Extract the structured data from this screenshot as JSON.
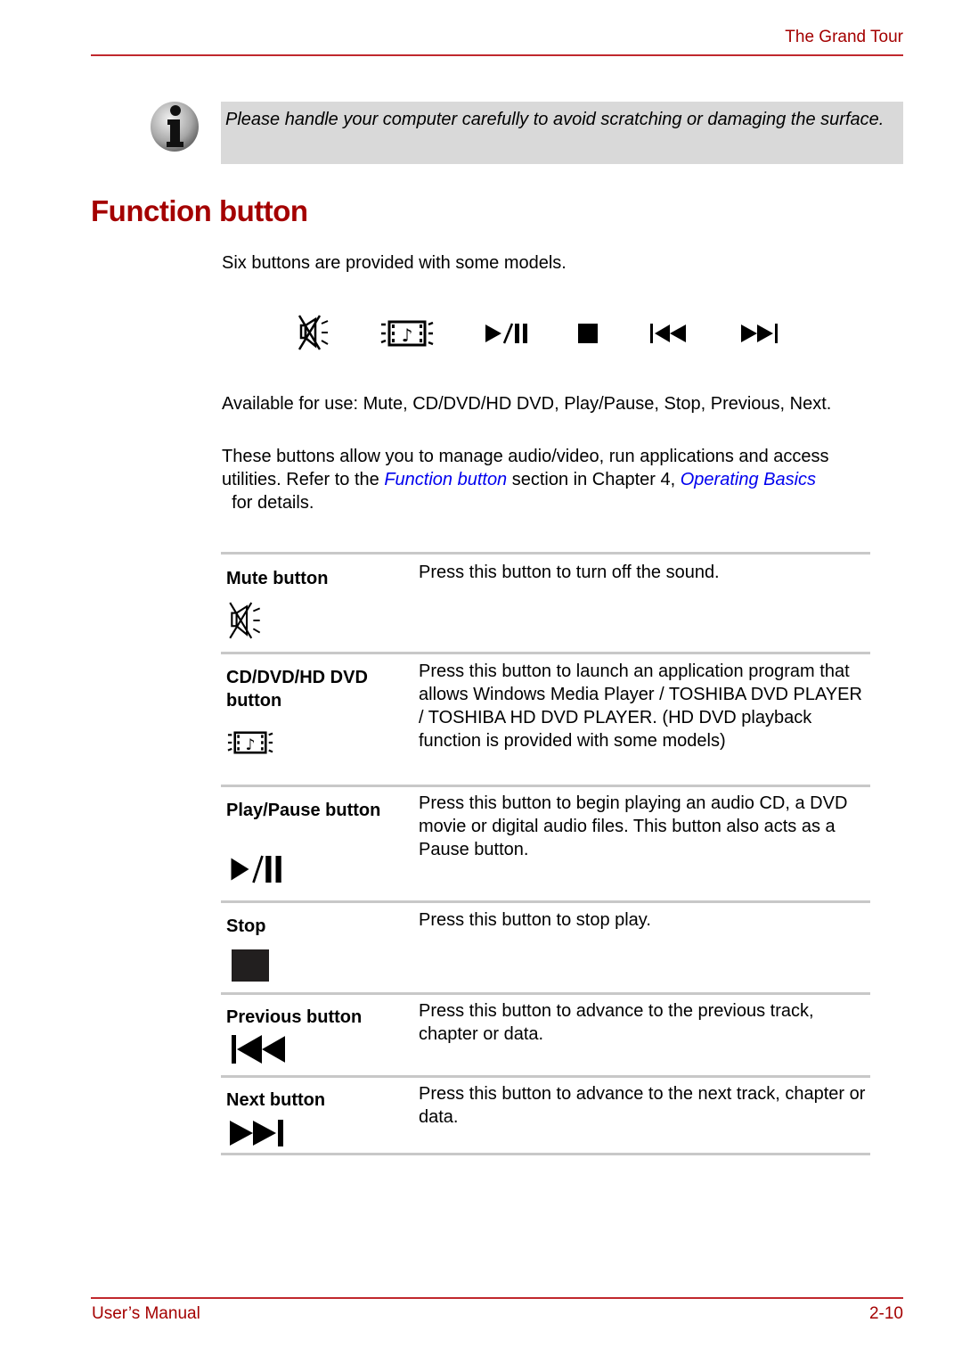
{
  "header": {
    "title": "The Grand Tour"
  },
  "note": {
    "icon": "info-icon",
    "text": "Please handle your computer carefully to avoid scratching or damaging the surface."
  },
  "section": {
    "title": "Function button",
    "intro": "Six buttons are provided with some models.",
    "icon_strip": [
      "mute-icon",
      "cd-dvd-icon",
      "play-pause-icon",
      "stop-icon",
      "previous-icon",
      "next-icon"
    ],
    "available": "Available for use: Mute, CD/DVD/HD DVD, Play/Pause, Stop, Previous, Next.",
    "manage_text_1": "These buttons allow you to manage audio/video, run applications and access utilities. Refer to the ",
    "manage_link_1": "Function button",
    "manage_text_2": " section in Chapter 4, ",
    "manage_link_2": "Operating Basics",
    "manage_text_3": "  for details."
  },
  "table": {
    "rows": [
      {
        "label": "Mute button",
        "icon": "mute-icon",
        "description": "Press this button to turn off the sound."
      },
      {
        "label": "CD/DVD/HD DVD button",
        "icon": "cd-dvd-icon",
        "description": "Press this button to launch an application program that allows Windows Media Player / TOSHIBA DVD PLAYER / TOSHIBA HD DVD PLAYER. (HD DVD playback function is provided with some models)"
      },
      {
        "label": "Play/Pause button",
        "icon": "play-pause-icon",
        "description": "Press this button to begin playing an audio CD, a DVD movie or digital audio files. This button also acts as a Pause button."
      },
      {
        "label": "Stop",
        "icon": "stop-icon",
        "description": "Press this button to stop play."
      },
      {
        "label": "Previous button",
        "icon": "previous-icon",
        "description": "Press this button to advance to the previous track, chapter or data."
      },
      {
        "label": "Next button",
        "icon": "next-icon",
        "description": "Press this button to advance to the next track, chapter or data."
      }
    ]
  },
  "footer": {
    "left": "User’s Manual",
    "right": "2-10"
  },
  "colors": {
    "brand_red": "#a40000",
    "rule_red": "#c0282d",
    "link_blue": "#0000ee",
    "note_bg": "#d9d9d9",
    "table_rule": "#c8c8c8"
  }
}
